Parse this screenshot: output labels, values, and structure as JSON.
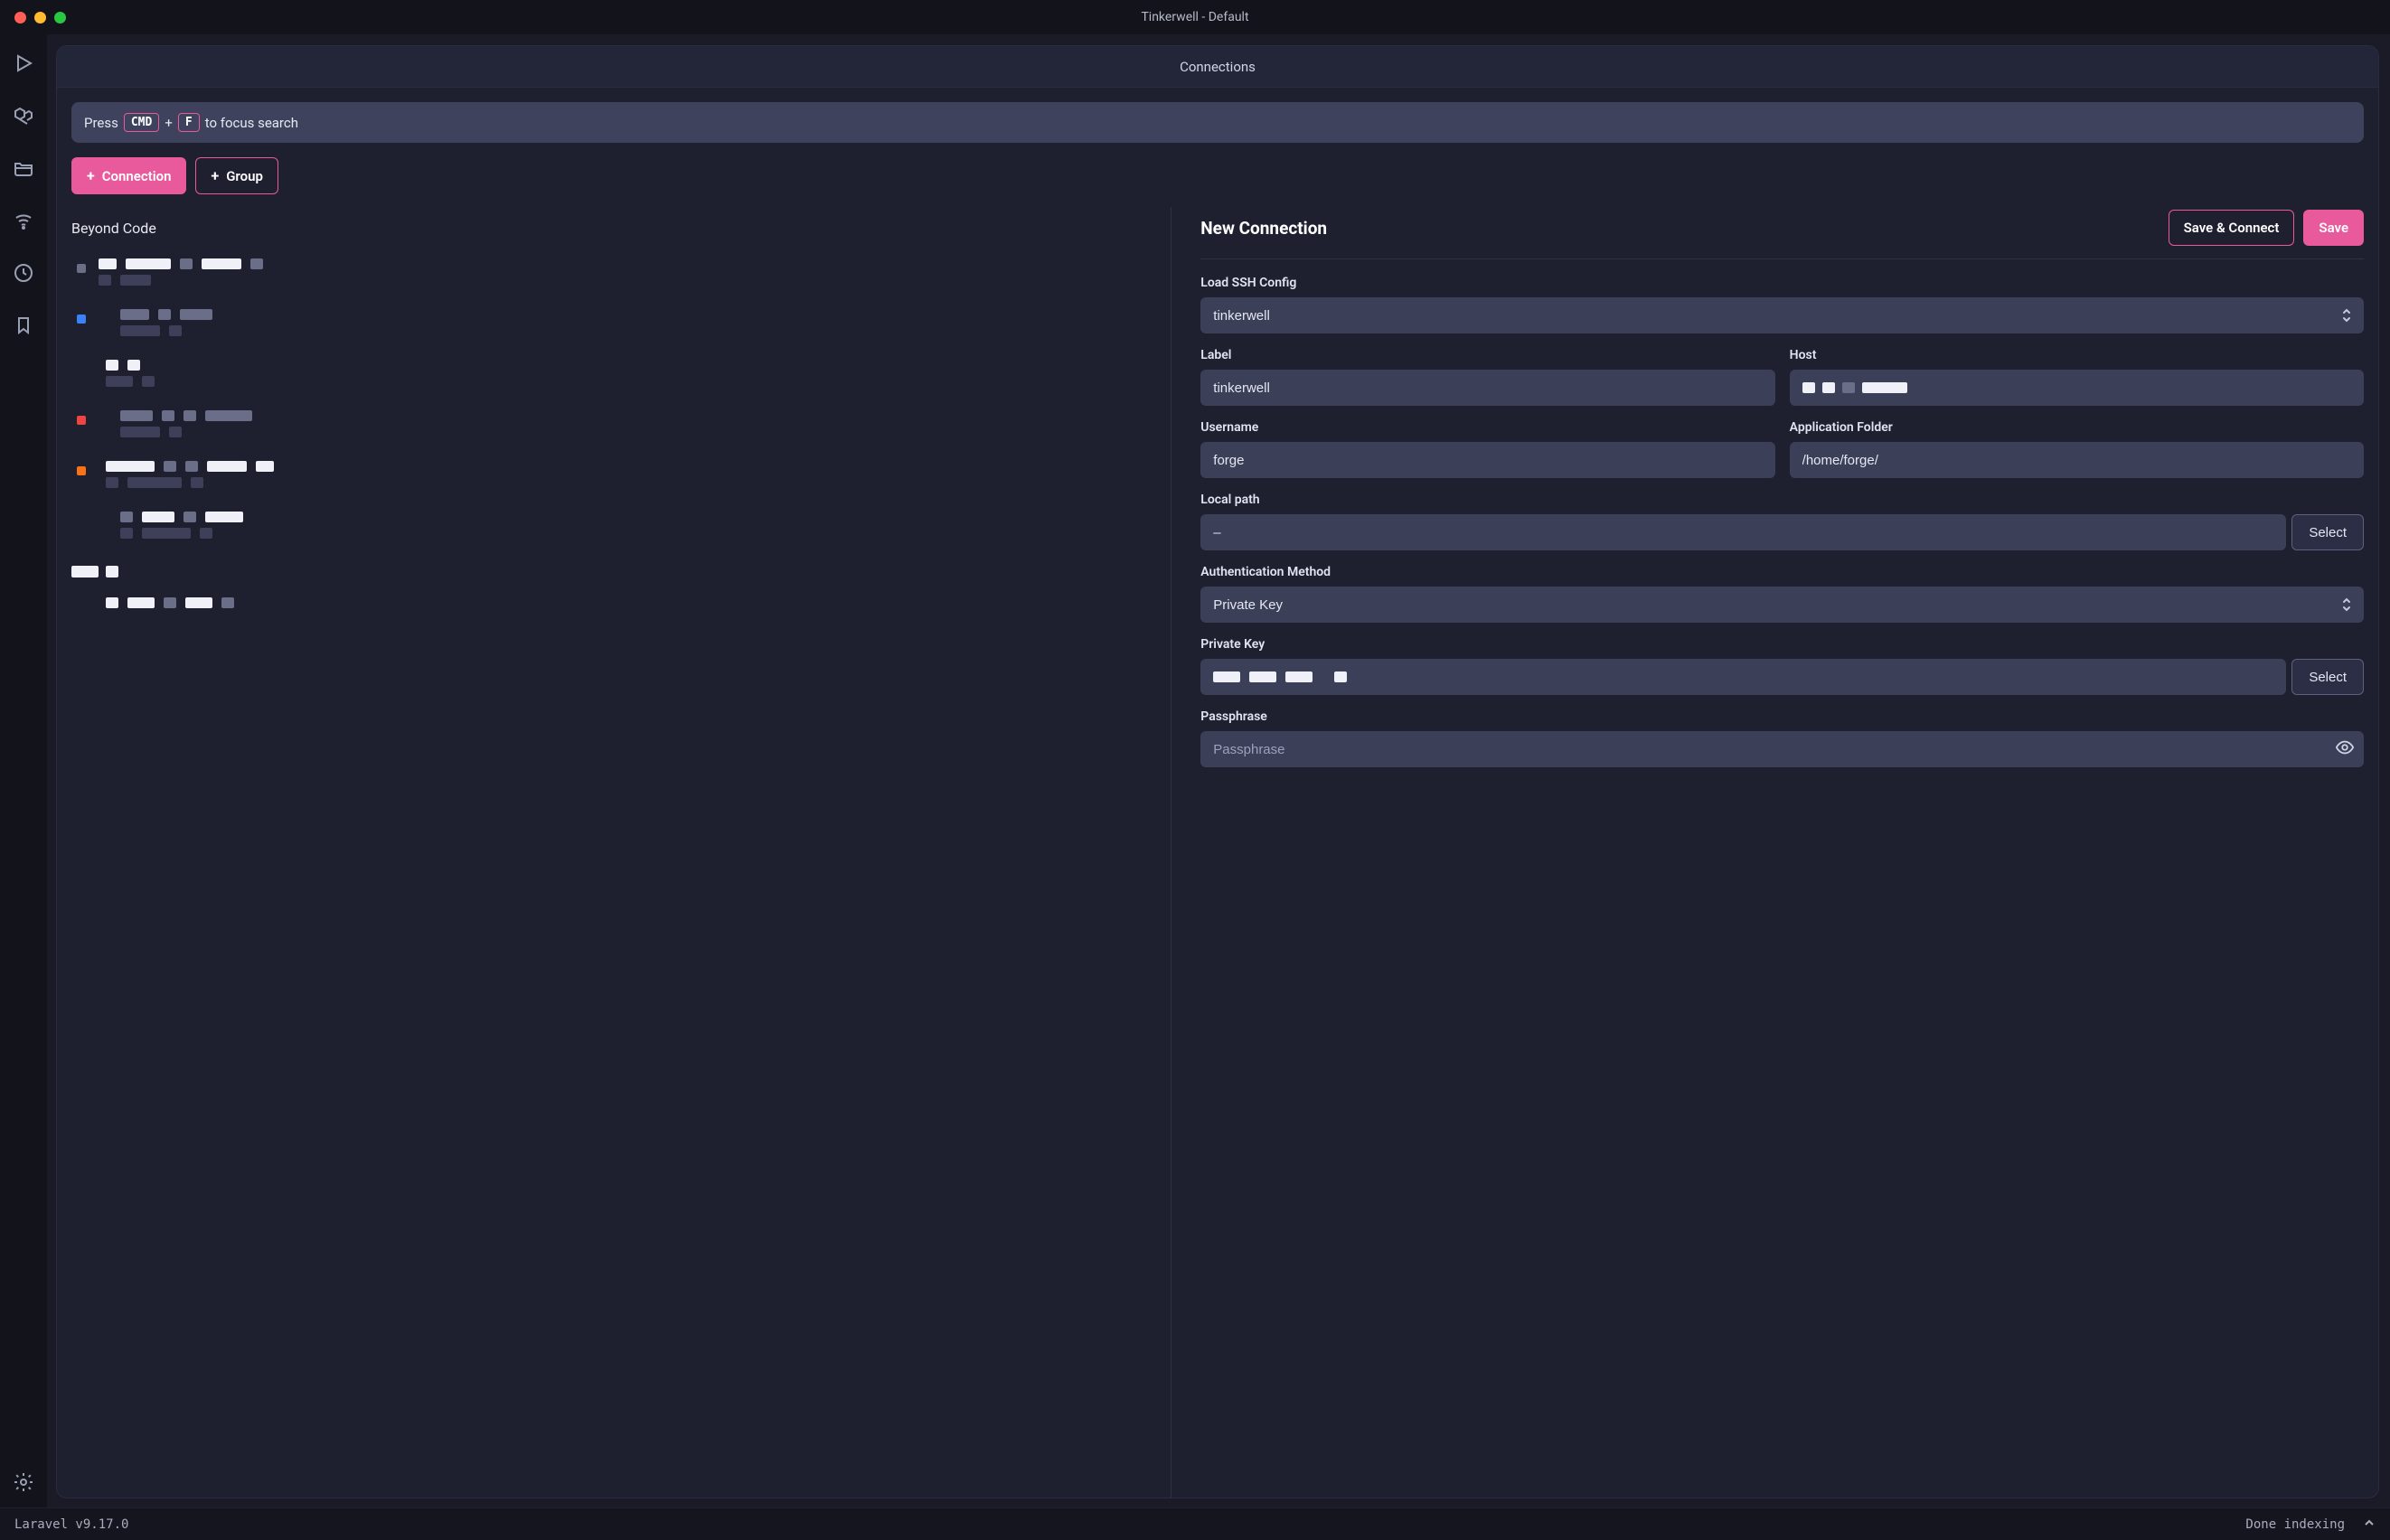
{
  "window": {
    "title": "Tinkerwell - Default"
  },
  "panel": {
    "title": "Connections"
  },
  "search_hint": {
    "prefix": "Press",
    "key1": "CMD",
    "plus": "+",
    "key2": "F",
    "suffix": "to focus search"
  },
  "actions": {
    "connection": "Connection",
    "group": "Group"
  },
  "sidebar_icons": {
    "run": "run-icon",
    "laravel": "laravel-icon",
    "folder": "folder-icon",
    "remote": "remote-icon",
    "history": "history-icon",
    "bookmark": "bookmark-icon",
    "settings": "settings-icon"
  },
  "left": {
    "group_title": "Beyond Code"
  },
  "form": {
    "title": "New Connection",
    "save_connect": "Save & Connect",
    "save": "Save",
    "fields": {
      "ssh_config_label": "Load SSH Config",
      "ssh_config_value": "tinkerwell",
      "label_label": "Label",
      "label_value": "tinkerwell",
      "host_label": "Host",
      "host_value": "",
      "username_label": "Username",
      "username_value": "forge",
      "app_folder_label": "Application Folder",
      "app_folder_value": "/home/forge/",
      "local_path_label": "Local path",
      "local_path_value": "–",
      "select_btn": "Select",
      "auth_method_label": "Authentication Method",
      "auth_method_value": "Private Key",
      "private_key_label": "Private Key",
      "private_key_value": "",
      "passphrase_label": "Passphrase",
      "passphrase_placeholder": "Passphrase"
    }
  },
  "status": {
    "left": "Laravel v9.17.0",
    "right": "Done indexing"
  }
}
